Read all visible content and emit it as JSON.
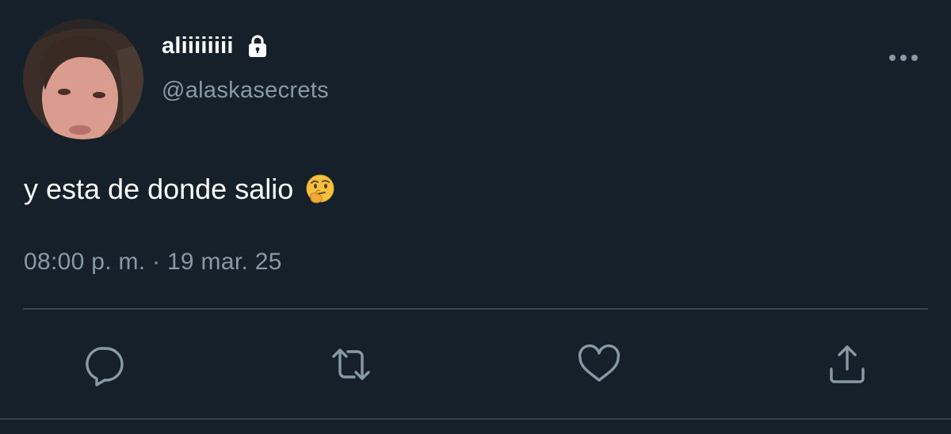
{
  "user": {
    "display_name": "aliiiiiiii",
    "handle": "@alaskasecrets",
    "protected_icon": "lock-icon",
    "avatar_icon": "profile-photo"
  },
  "tweet": {
    "text": "y esta de donde salio",
    "emoji": "thinking-face-emoji",
    "timestamp": "08:00 p. m. · 19 mar. 25"
  },
  "actions": [
    {
      "name": "reply",
      "icon": "reply-icon"
    },
    {
      "name": "retweet",
      "icon": "retweet-icon"
    },
    {
      "name": "like",
      "icon": "heart-icon"
    },
    {
      "name": "share",
      "icon": "share-icon"
    }
  ],
  "menu": {
    "icon": "more-options-icon"
  },
  "colors": {
    "background": "#15202b",
    "primary_text": "#ffffff",
    "secondary_text": "#8899a6",
    "divider": "#38444d"
  }
}
